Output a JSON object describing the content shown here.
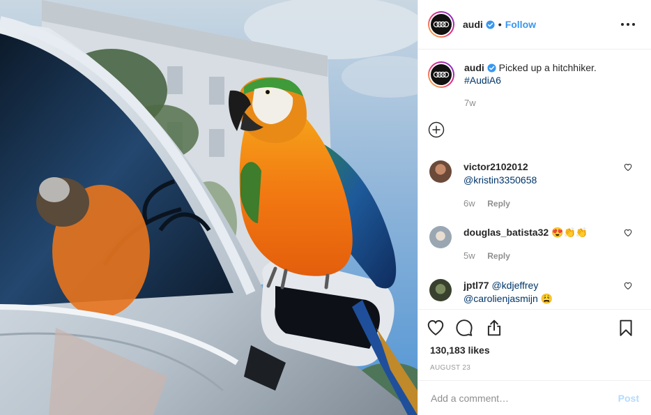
{
  "post": {
    "author": {
      "username": "audi",
      "verified": true,
      "avatar_icon": "audi-rings-icon",
      "follow_label": "Follow",
      "dot": "•"
    },
    "more_icon": "more-options-icon",
    "caption": {
      "username": "audi",
      "text": "Picked up a hitchhiker.",
      "hashtag": "#AudiA6",
      "time": "7w"
    },
    "load_more_icon": "plus-circle-icon",
    "comments": [
      {
        "username": "victor2102012",
        "text": "@kristin3350658",
        "time": "6w",
        "reply_label": "Reply",
        "avatar_color": "#6b4a3a"
      },
      {
        "username": "douglas_batista32",
        "text": "😍👏👏",
        "time": "5w",
        "reply_label": "Reply",
        "avatar_color": "#9aa7b3"
      },
      {
        "username": "jptl77",
        "text": "@kdjeffrey @carolienjasmijn 😩",
        "mention1": "@kdjeffrey",
        "mention2": "@carolienjasmijn",
        "emoji": "😩",
        "avatar_color": "#39412e"
      }
    ],
    "actions": {
      "like_icon": "heart-icon",
      "comment_icon": "comment-icon",
      "share_icon": "share-icon",
      "save_icon": "bookmark-icon"
    },
    "likes": "130,183 likes",
    "date": "AUGUST 23",
    "add_comment": {
      "placeholder": "Add a comment…",
      "post_label": "Post"
    }
  },
  "colors": {
    "accent": "#3897f0",
    "hashtag": "#003569",
    "muted": "#8e8e8e",
    "post_disabled": "#b3dbff",
    "border": "#efefef"
  }
}
